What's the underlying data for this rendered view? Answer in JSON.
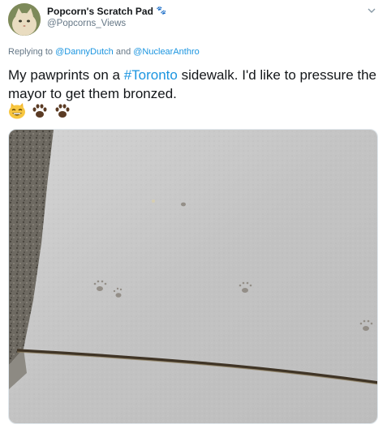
{
  "author": {
    "display_name": "Popcorn's Scratch Pad",
    "badge": "🐾",
    "handle": "@Popcorns_Views"
  },
  "reply": {
    "prefix": "Replying to ",
    "user1": "@DannyDutch",
    "conjunction": " and ",
    "user2": "@NuclearAnthro"
  },
  "tweet": {
    "text_before": "My pawprints on a ",
    "hashtag": "#Toronto",
    "text_after": " sidewalk.  I'd like to pressure the mayor to get them bronzed."
  },
  "emojis": [
    "grinning-cat-icon",
    "paw-icon",
    "paw-icon"
  ],
  "colors": {
    "link": "#1b95e0",
    "secondary_text": "#657786",
    "paw": "#5b3b24",
    "sidewalk": "#c7c7c7"
  },
  "icons": [
    "avatar-cat",
    "chevron-down-icon",
    "grinning-cat-icon",
    "paw-icon"
  ]
}
